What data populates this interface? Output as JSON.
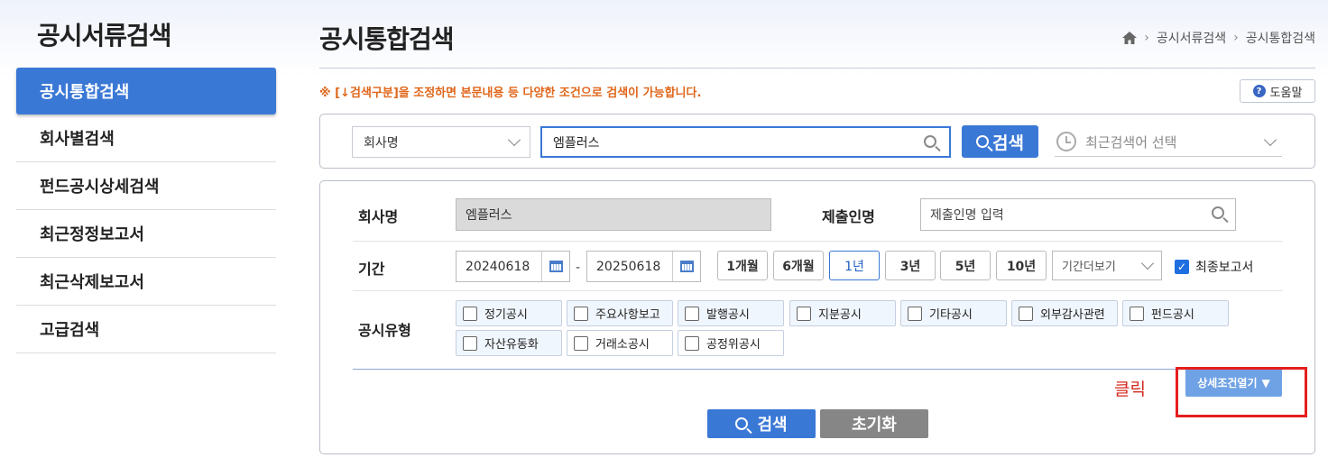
{
  "sidebar": {
    "title": "공시서류검색",
    "items": [
      {
        "label": "공시통합검색",
        "active": true
      },
      {
        "label": "회사별검색"
      },
      {
        "label": "펀드공시상세검색"
      },
      {
        "label": "최근정정보고서"
      },
      {
        "label": "최근삭제보고서"
      },
      {
        "label": "고급검색"
      }
    ]
  },
  "header": {
    "title": "공시통합검색",
    "breadcrumb": [
      "공시서류검색",
      "공시통합검색"
    ],
    "notice": "※ [↓검색구분]을 조정하면 본문내용 등 다양한 조건으로 검색이 가능합니다.",
    "help_label": "도움말"
  },
  "search": {
    "type_selected": "회사명",
    "query": "엠플러스",
    "button_label": "검색",
    "recent_placeholder": "최근검색어 선택"
  },
  "filters": {
    "company_label": "회사명",
    "company_value": "엠플러스",
    "submitter_label": "제출인명",
    "submitter_placeholder": "제출인명 입력",
    "period_label": "기간",
    "date_from": "20240618",
    "date_sep": "-",
    "date_to": "20250618",
    "period_buttons": [
      "1개월",
      "6개월",
      "1년",
      "3년",
      "5년",
      "10년"
    ],
    "period_selected": "1년",
    "period_more": "기간더보기",
    "final_report_label": "최종보고서",
    "final_report_checked": true,
    "type_label": "공시유형",
    "types": [
      "정기공시",
      "주요사항보고",
      "발행공시",
      "지분공시",
      "기타공시",
      "외부감사관련",
      "펀드공시",
      "자산유동화",
      "거래소공시",
      "공정위공시"
    ],
    "click_annotation": "클릭",
    "detail_button": "상세조건열기",
    "detail_arrow": "▼",
    "bottom_search": "검색",
    "reset": "초기화"
  },
  "colors": {
    "primary": "#3a78d6",
    "notice": "#e0661a",
    "annotation": "#e51e1e",
    "reset": "#868686"
  }
}
